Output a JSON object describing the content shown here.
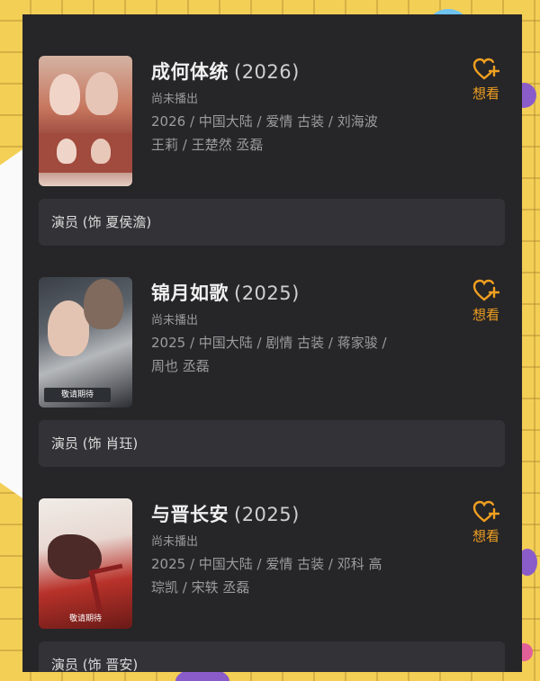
{
  "movies": [
    {
      "title": "成何体统",
      "year": "(2026)",
      "status": "尚未播出",
      "meta_line1": "2026 / 中国大陆 / 爱情 古装 / 刘海波",
      "meta_line2": "王莉 / 王楚然 丞磊",
      "want_label": "想看",
      "role": "演员 (饰 夏侯澹)"
    },
    {
      "title": "锦月如歌",
      "year": "(2025)",
      "status": "尚未播出",
      "meta_line1": "2025 / 中国大陆 / 剧情 古装 / 蒋家骏 /",
      "meta_line2": "周也 丞磊",
      "want_label": "想看",
      "role": "演员 (饰 肖珏)",
      "poster_tag": "敬请期待"
    },
    {
      "title": "与晋长安",
      "year": "(2025)",
      "status": "尚未播出",
      "meta_line1": "2025 / 中国大陆 / 爱情 古装 / 邓科 高",
      "meta_line2": "琮凯 / 宋轶 丞磊",
      "want_label": "想看",
      "role": "演员 (饰 晋安)",
      "poster_tag": "敬请期待"
    }
  ],
  "colors": {
    "panel": "#262528",
    "accent": "#f0a020",
    "background": "#f3cf55"
  }
}
